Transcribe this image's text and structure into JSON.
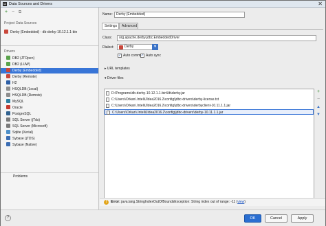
{
  "window": {
    "app_icon": "IJ",
    "title": "Data Sources and Drivers",
    "close": "✕"
  },
  "toolbar": {
    "add": "+",
    "remove": "−",
    "copy": "⧉"
  },
  "left": {
    "project_header": "Project Data Sources",
    "project_item": "Derby (Embedded) - db-derby-10.12.1.1-bin",
    "drivers_header": "Drivers",
    "drivers": [
      {
        "label": "DB2 (JTOpen)",
        "color": "#5aa34b"
      },
      {
        "label": "DB2 (LUW)",
        "color": "#5aa34b"
      },
      {
        "label": "Derby (Embedded)",
        "color": "#c9473b"
      },
      {
        "label": "Derby (Remote)",
        "color": "#c9473b"
      },
      {
        "label": "H2",
        "color": "#2d5fa6"
      },
      {
        "label": "HSQLDB (Local)",
        "color": "#8e8e8e"
      },
      {
        "label": "HSQLDB (Remote)",
        "color": "#8e8e8e"
      },
      {
        "label": "MySQL",
        "color": "#2b7ea1"
      },
      {
        "label": "Oracle",
        "color": "#c53a2f"
      },
      {
        "label": "PostgreSQL",
        "color": "#31628f"
      },
      {
        "label": "SQL Server (jTds)",
        "color": "#7a7a7a"
      },
      {
        "label": "SQL Server (Microsoft)",
        "color": "#7a7a7a"
      },
      {
        "label": "Sqlite (Xerial)",
        "color": "#4d8fc9"
      },
      {
        "label": "Sybase (jTDS)",
        "color": "#3b6db3"
      },
      {
        "label": "Sybase (Native)",
        "color": "#3b6db3"
      }
    ],
    "selected_driver_index": 2,
    "problems": "Problems"
  },
  "form": {
    "name_label": "Name:",
    "name_value": "Derby (Embedded)",
    "tabs": [
      "Settings",
      "Advanced"
    ],
    "class_label": "Class:",
    "class_value": "org.apache.derby.jdbc.EmbeddedDriver",
    "dialect_label": "Dialect:",
    "dialect_value": "Derby",
    "auto_commit": "Auto commit",
    "auto_sync": "Auto sync",
    "url_templates": "URL templates",
    "driver_files": "Driver files",
    "files": [
      "D:\\Programs\\db-derby-10.12.1.1-bin\\lib\\derby.jar",
      "C:\\Users\\Orkan\\.IntelliJIdea2016.2\\config\\jdbc-drivers\\derby-license.txt",
      "C:\\Users\\Orkan\\.IntelliJIdea2016.2\\config\\jdbc-drivers\\derbyclient-10.11.1.1.jar",
      "C:\\Users\\Orkan\\.IntelliJIdea2016.2\\config\\jdbc-drivers\\derby-10.11.1.1.jar"
    ],
    "selected_file_index": 3
  },
  "error": {
    "prefix": "Error:",
    "message": "java.lang.StringIndexOutOfBoundsException: String index out of range: -11",
    "link_open": "(",
    "link": "view",
    "link_close": ")"
  },
  "buttons": {
    "help": "?",
    "ok": "OK",
    "cancel": "Cancel",
    "apply": "Apply"
  },
  "colors": {
    "selection": "#3875d7",
    "primary": "#2a6ed1",
    "warning": "#e2a51b"
  }
}
